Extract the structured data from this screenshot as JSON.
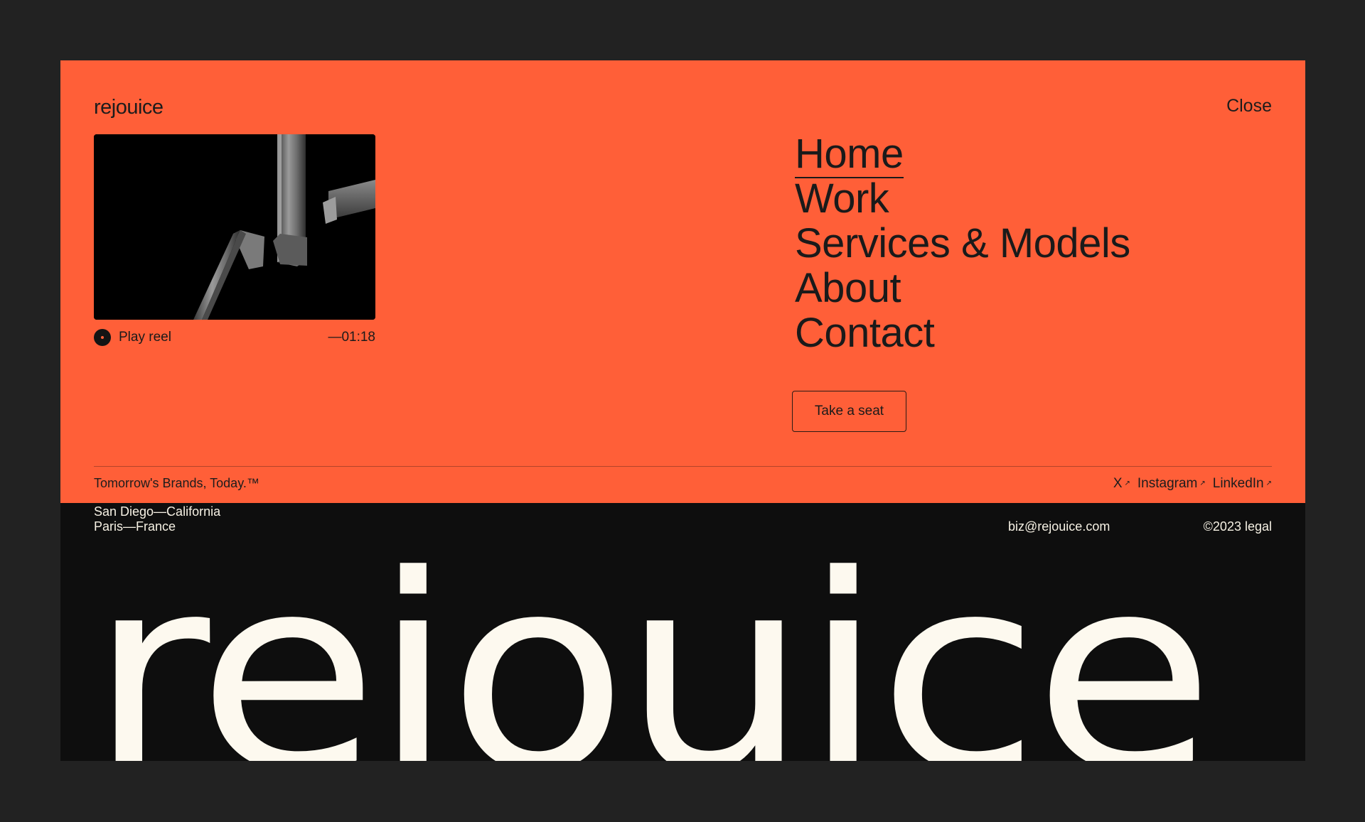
{
  "colors": {
    "accent": "#ff5f38",
    "footer_bg": "#0e0e0e",
    "cream": "#fdf9ef",
    "backdrop": "#222222"
  },
  "header": {
    "logo": "rejouice",
    "close_label": "Close"
  },
  "reel": {
    "play_label": "Play reel",
    "duration": "—01:18",
    "icon": "play-dot-icon"
  },
  "nav": {
    "items": [
      {
        "label": "Home",
        "active": true
      },
      {
        "label": "Work",
        "active": false
      },
      {
        "label": "Services & Models",
        "active": false
      },
      {
        "label": "About",
        "active": false
      },
      {
        "label": "Contact",
        "active": false
      }
    ],
    "cta_label": "Take a seat"
  },
  "strip": {
    "tagline": "Tomorrow's Brands, Today.™",
    "socials": [
      {
        "label": "X",
        "icon": "arrow-up-right-icon"
      },
      {
        "label": "Instagram",
        "icon": "arrow-up-right-icon"
      },
      {
        "label": "LinkedIn",
        "icon": "arrow-up-right-icon"
      }
    ]
  },
  "footer": {
    "locations": [
      "San Diego—California",
      "Paris—France"
    ],
    "email": "biz@rejouice.com",
    "legal": "©2023 legal",
    "big_logo": "rejouice"
  }
}
